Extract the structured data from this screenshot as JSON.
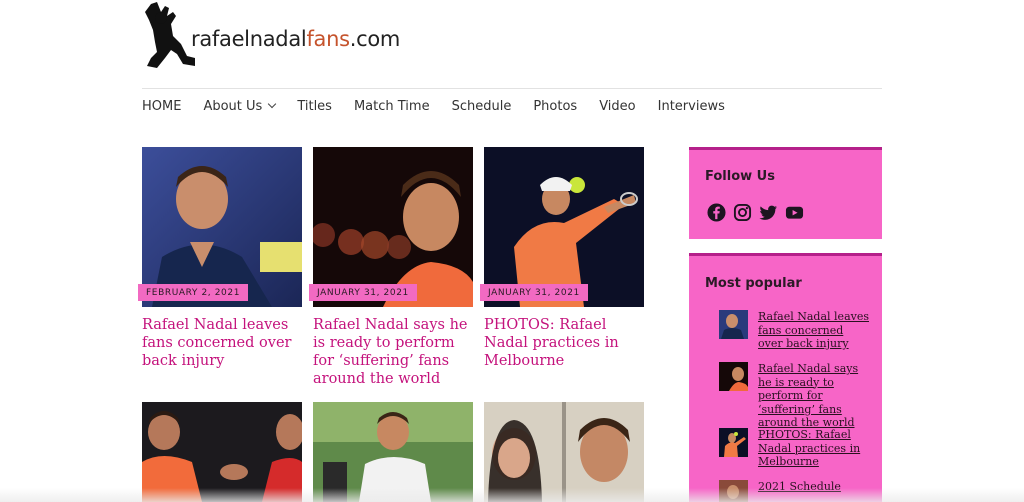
{
  "site": {
    "logo_part1": "rafaelnadal",
    "logo_part2": "fans",
    "logo_part3": ".com"
  },
  "nav": [
    {
      "label": "HOME"
    },
    {
      "label": "About Us",
      "has_dropdown": true
    },
    {
      "label": "Titles"
    },
    {
      "label": "Match Time"
    },
    {
      "label": "Schedule"
    },
    {
      "label": "Photos"
    },
    {
      "label": "Video"
    },
    {
      "label": "Interviews"
    }
  ],
  "posts": [
    {
      "date": "FEBRUARY 2, 2021",
      "title": "Rafael Nadal leaves fans concerned over back injury"
    },
    {
      "date": "JANUARY 31, 2021",
      "title": "Rafael Nadal says he is ready to perform for ‘suffering’ fans around the world"
    },
    {
      "date": "JANUARY 31, 2021",
      "title": "PHOTOS: Rafael Nadal practices in Melbourne"
    }
  ],
  "sidebar": {
    "follow_title": "Follow Us",
    "social_icons": [
      "facebook-icon",
      "instagram-icon",
      "twitter-icon",
      "youtube-icon"
    ],
    "popular_title": "Most popular",
    "popular": [
      {
        "title": "Rafael Nadal leaves fans concerned over back injury"
      },
      {
        "title": "Rafael Nadal says he is ready to perform for ‘suffering’ fans around the world"
      },
      {
        "title": "PHOTOS: Rafael Nadal practices in Melbourne"
      },
      {
        "title": "2021 Schedule"
      }
    ]
  },
  "colors": {
    "accent_pink": "#f765c7",
    "title_magenta": "#c4127c",
    "logo_orange": "#c5532c"
  }
}
